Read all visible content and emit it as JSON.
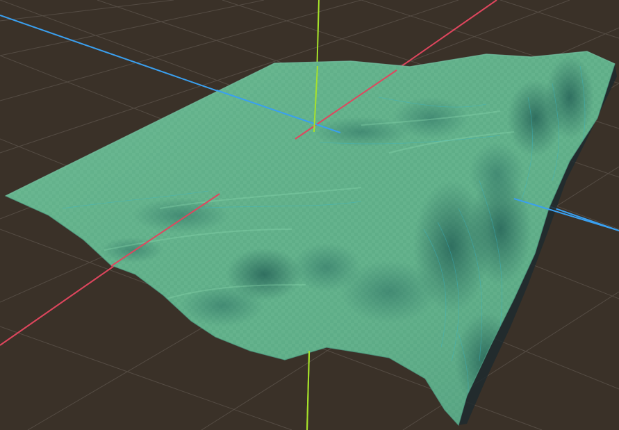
{
  "viewport": {
    "background_color": "#3a3128",
    "grid_color": "#6a625a",
    "axes": {
      "x_color": "#e0465e",
      "y_color": "#a6e22a",
      "z_color": "#3aa0f0"
    },
    "terrain": {
      "fill_color": "#5fae88",
      "light_color": "#7cc79d",
      "shadow_color": "#2f6f63",
      "wire_color": "#36b8cf",
      "pattern": "checkerboard",
      "edge_color": "#1f2a2e"
    }
  }
}
